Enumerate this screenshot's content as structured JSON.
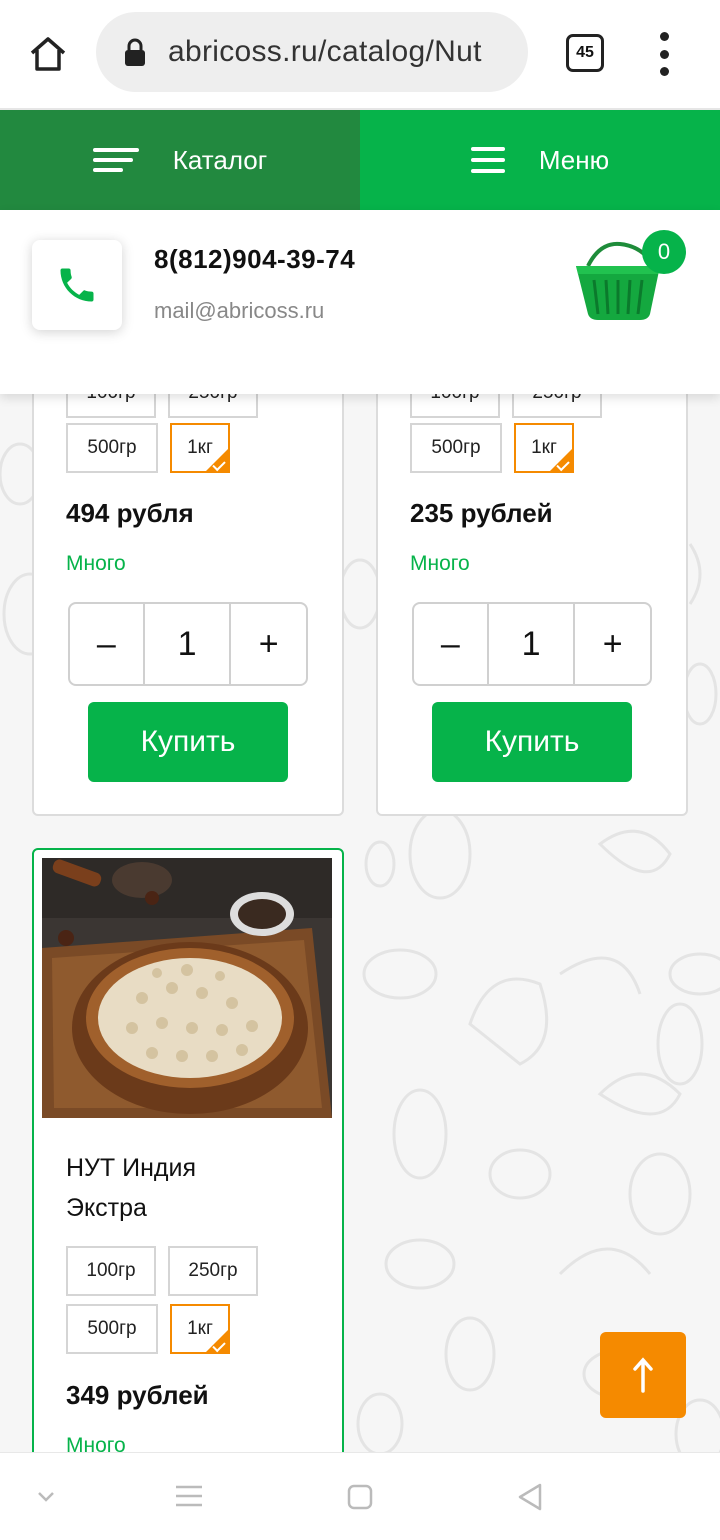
{
  "browser": {
    "url": "abricoss.ru/catalog/Nut",
    "tab_count": "45",
    "icons": [
      "home-icon",
      "lock-icon",
      "tabs-icon",
      "more-icon"
    ]
  },
  "site_nav": {
    "catalog_label": "Каталог",
    "menu_label": "Меню"
  },
  "contact": {
    "phone": "8(812)904-39-74",
    "email": "mail@abricoss.ru",
    "cart_count": "0"
  },
  "products": [
    {
      "weights": [
        "100гр",
        "250гр",
        "500гр",
        "1кг"
      ],
      "selected_weight": "1кг",
      "price": "494 рубля",
      "stock": "Много",
      "quantity": "1",
      "buy_label": "Купить"
    },
    {
      "weights": [
        "100гр",
        "250гр",
        "500гр",
        "1кг"
      ],
      "selected_weight": "1кг",
      "price": "235 рублей",
      "stock": "Много",
      "quantity": "1",
      "buy_label": "Купить"
    },
    {
      "title_line1": "НУТ Индия",
      "title_line2": "Экстра",
      "weights": [
        "100гр",
        "250гр",
        "500гр",
        "1кг"
      ],
      "selected_weight": "1кг",
      "price": "349 рублей",
      "stock": "Много"
    }
  ],
  "qty_controls": {
    "minus": "–",
    "plus": "+"
  },
  "colors": {
    "brand_green": "#06b34a",
    "dark_green": "#22893f",
    "accent_orange": "#f58a00"
  }
}
